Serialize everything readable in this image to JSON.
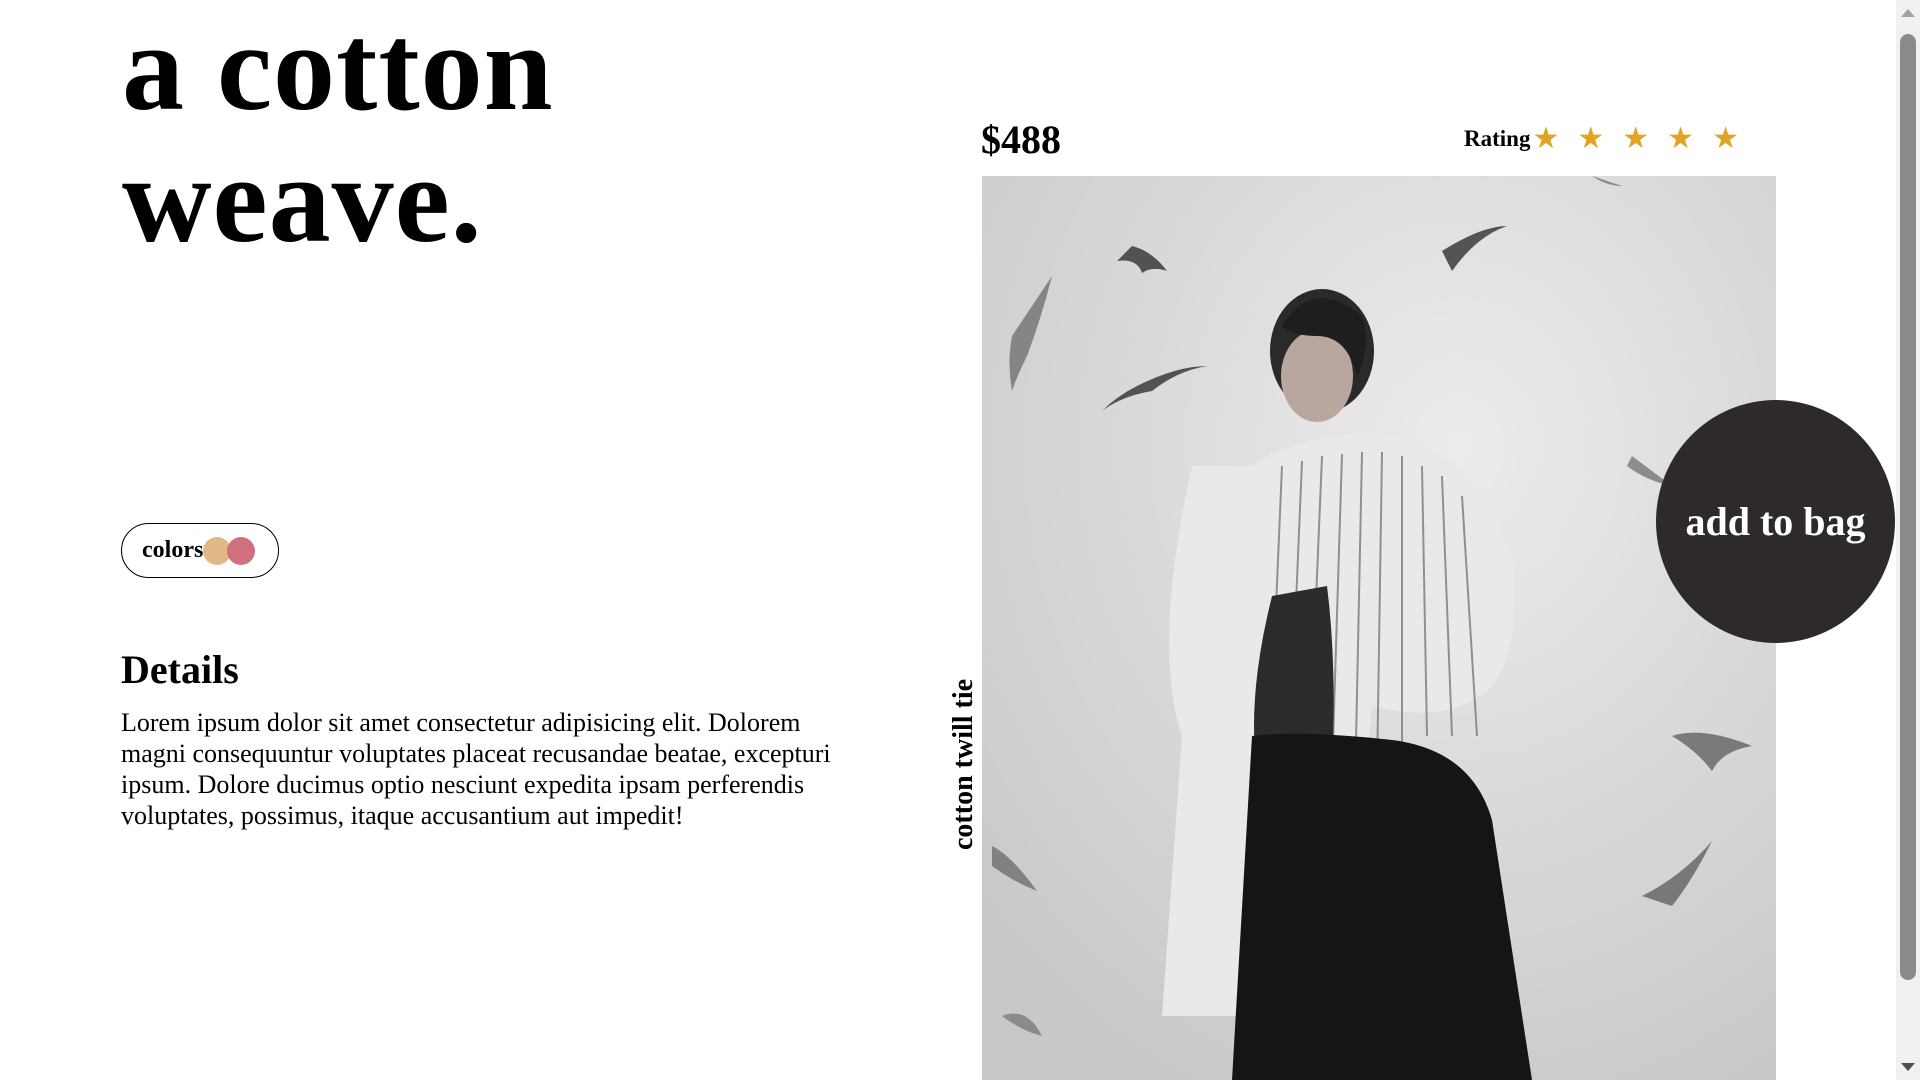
{
  "hero": {
    "line1": "a cotton",
    "line2": "weave."
  },
  "colors": {
    "label": "colors",
    "swatches": [
      {
        "name": "tan",
        "hex": "#e0b885"
      },
      {
        "name": "rose",
        "hex": "#d0707f"
      }
    ]
  },
  "details": {
    "title": "Details",
    "text": "Lorem ipsum dolor sit amet consectetur adipisicing elit. Dolorem magni consequuntur voluptates placeat recusandae beatae, excepturi ipsum. Dolore ducimus optio nesciunt expedita ipsam perferendis voluptates, possimus, itaque accusantium aut impedit!"
  },
  "product": {
    "price": "$488",
    "name": "cotton twill tie",
    "image_icon": "photo-model-with-birds",
    "rating": {
      "label": "Rating",
      "stars": 5,
      "star_color": "#e0a526"
    }
  },
  "actions": {
    "add_to_bag": "add to bag",
    "button_color": "#2e2a2b"
  }
}
